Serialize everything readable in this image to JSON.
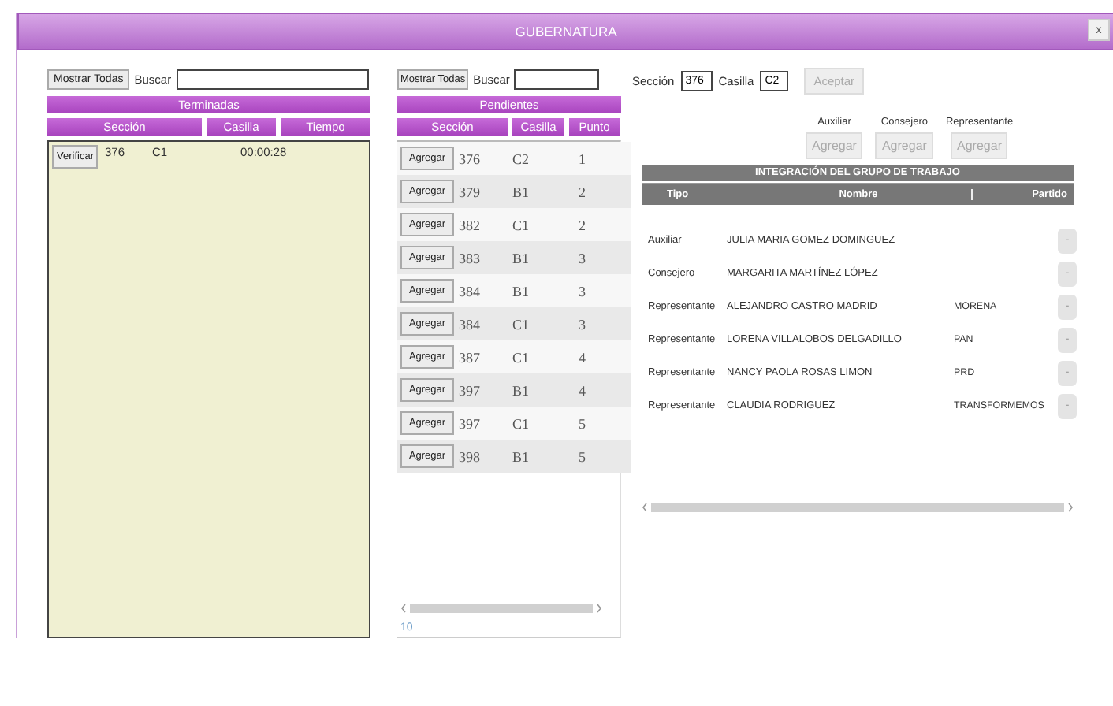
{
  "window": {
    "title": "GUBERNATURA",
    "close": "x"
  },
  "terminadas": {
    "show_all": "Mostrar Todas",
    "search_label": "Buscar",
    "title": "Terminadas",
    "columns": [
      "Sección",
      "Casilla",
      "Tiempo"
    ],
    "rows": [
      {
        "action": "Verificar",
        "seccion": "376",
        "casilla": "C1",
        "tiempo": "00:00:28"
      }
    ]
  },
  "pendientes": {
    "show_all": "Mostrar Todas",
    "search_label": "Buscar",
    "title": "Pendientes",
    "columns": [
      "Sección",
      "Casilla",
      "Punto"
    ],
    "rows": [
      {
        "action": "Agregar",
        "seccion": "376",
        "casilla": "C2",
        "punto": "1"
      },
      {
        "action": "Agregar",
        "seccion": "379",
        "casilla": "B1",
        "punto": "2"
      },
      {
        "action": "Agregar",
        "seccion": "382",
        "casilla": "C1",
        "punto": "2"
      },
      {
        "action": "Agregar",
        "seccion": "383",
        "casilla": "B1",
        "punto": "3"
      },
      {
        "action": "Agregar",
        "seccion": "384",
        "casilla": "B1",
        "punto": "3"
      },
      {
        "action": "Agregar",
        "seccion": "384",
        "casilla": "C1",
        "punto": "3"
      },
      {
        "action": "Agregar",
        "seccion": "387",
        "casilla": "C1",
        "punto": "4"
      },
      {
        "action": "Agregar",
        "seccion": "397",
        "casilla": "B1",
        "punto": "4"
      },
      {
        "action": "Agregar",
        "seccion": "397",
        "casilla": "C1",
        "punto": "5"
      },
      {
        "action": "Agregar",
        "seccion": "398",
        "casilla": "B1",
        "punto": "5"
      }
    ],
    "count": "10"
  },
  "form": {
    "seccion_label": "Sección",
    "seccion": "376",
    "casilla_label": "Casilla",
    "casilla": "C2",
    "accept": "Aceptar",
    "accept_disabled": true
  },
  "add_buttons": [
    {
      "label": "Auxiliar",
      "button": "Agregar",
      "disabled": true
    },
    {
      "label": "Consejero",
      "button": "Agregar",
      "disabled": true
    },
    {
      "label": "Representante",
      "button": "Agregar",
      "disabled": true
    }
  ],
  "grupo": {
    "title": "INTEGRACIÓN DEL GRUPO DE TRABAJO",
    "columns": [
      "Tipo",
      "Nombre",
      "Partido"
    ],
    "rows": [
      {
        "tipo": "Auxiliar",
        "nombre": "JULIA MARIA GOMEZ DOMINGUEZ",
        "action": "-"
      },
      {
        "tipo": "Consejero",
        "nombre": "MARGARITA MARTÍNEZ LÓPEZ",
        "action": "-"
      },
      {
        "tipo": "Representante",
        "nombre": "ALEJANDRO CASTRO MADRID",
        "partido": "MORENA",
        "action": "-"
      },
      {
        "tipo": "Representante",
        "nombre": "LORENA VILLALOBOS DELGADILLO",
        "partido": "PAN",
        "action": "-"
      },
      {
        "tipo": "Representante",
        "nombre": "NANCY PAOLA ROSAS LIMON",
        "partido": "PRD",
        "action": "-"
      },
      {
        "tipo": "Representante",
        "nombre": "CLAUDIA RODRIGUEZ",
        "partido": "TRANSFORMEMOS",
        "action": "-"
      }
    ]
  }
}
